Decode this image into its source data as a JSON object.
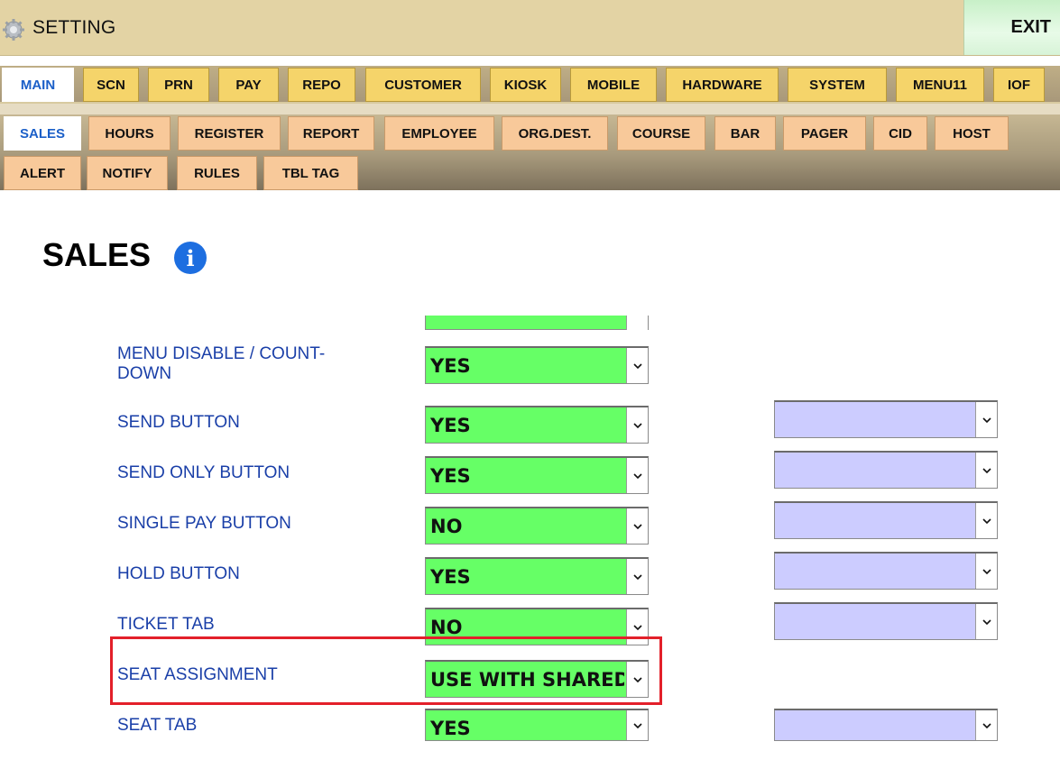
{
  "app": {
    "title": "SETTING",
    "exit_label": "EXIT"
  },
  "main_tabs": [
    "MAIN",
    "SCN",
    "PRN",
    "PAY",
    "REPO",
    "CUSTOMER",
    "KIOSK",
    "MOBILE",
    "HARDWARE",
    "SYSTEM",
    "MENU11",
    "IOF"
  ],
  "active_main_tab": "MAIN",
  "sub_tabs_row1": [
    "SALES",
    "HOURS",
    "REGISTER",
    "REPORT",
    "EMPLOYEE",
    "ORG.DEST.",
    "COURSE",
    "BAR",
    "PAGER",
    "CID",
    "HOST"
  ],
  "sub_tabs_row2": [
    "ALERT",
    "NOTIFY",
    "RULES",
    "TBL TAG"
  ],
  "active_sub_tab": "SALES",
  "page": {
    "heading": "SALES",
    "info_icon": "info-icon"
  },
  "colors": {
    "select_bg": "#66ff66",
    "secondary_select_bg": "#ccccff",
    "label": "#1a3fa8",
    "highlight": "#e3202a"
  },
  "settings": [
    {
      "label": "MENU DISABLE / COUNT-\nDOWN",
      "value": "YES",
      "secondary": false
    },
    {
      "label": "SEND BUTTON",
      "value": "YES",
      "secondary": true,
      "secondary_value": ""
    },
    {
      "label": "SEND ONLY BUTTON",
      "value": "YES",
      "secondary": true,
      "secondary_value": ""
    },
    {
      "label": "SINGLE PAY BUTTON",
      "value": "NO",
      "secondary": true,
      "secondary_value": ""
    },
    {
      "label": "HOLD BUTTON",
      "value": "YES",
      "secondary": true,
      "secondary_value": ""
    },
    {
      "label": "TICKET TAB",
      "value": "NO",
      "secondary": true,
      "secondary_value": ""
    },
    {
      "label": "SEAT ASSIGNMENT",
      "value": "USE WITH SHARED",
      "secondary": false,
      "highlighted": true
    },
    {
      "label": "SEAT TAB",
      "value": "YES",
      "secondary": true,
      "secondary_value": ""
    }
  ]
}
